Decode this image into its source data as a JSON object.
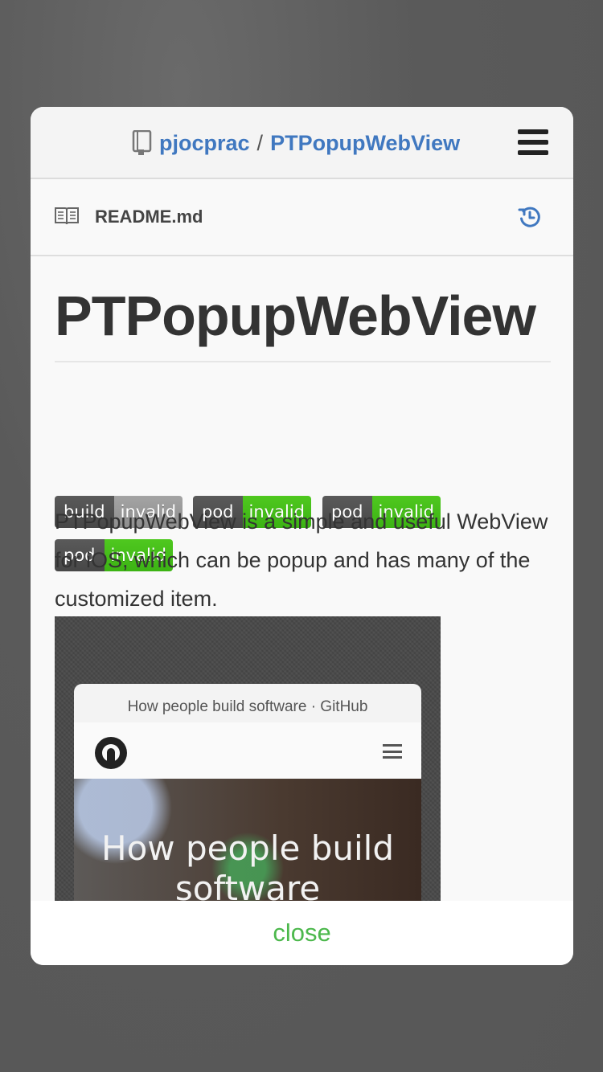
{
  "header": {
    "owner": "pjocprac",
    "separator": "/",
    "repo": "PTPopupWebView"
  },
  "readme": {
    "filename": "README.md"
  },
  "content": {
    "heading": "PTPopupWebView",
    "badges": [
      {
        "label": "build",
        "value": "invalid",
        "color": "#9a9a9a"
      },
      {
        "label": "pod",
        "value": "invalid",
        "color": "#44c31a"
      },
      {
        "label": "pod",
        "value": "invalid",
        "color": "#44c31a"
      },
      {
        "label": "pod",
        "value": "invalid",
        "color": "#44c31a"
      }
    ],
    "description": "PTPopupWebView is a simple and useful WebView for iOS, which can be popup and has many of the customized item."
  },
  "preview": {
    "title": "How people build software · GitHub",
    "hero_text": "How people build software"
  },
  "footer": {
    "close_label": "close"
  },
  "colors": {
    "link": "#4078c0",
    "close": "#4cb84c",
    "backdrop": "#5b5b5b"
  }
}
